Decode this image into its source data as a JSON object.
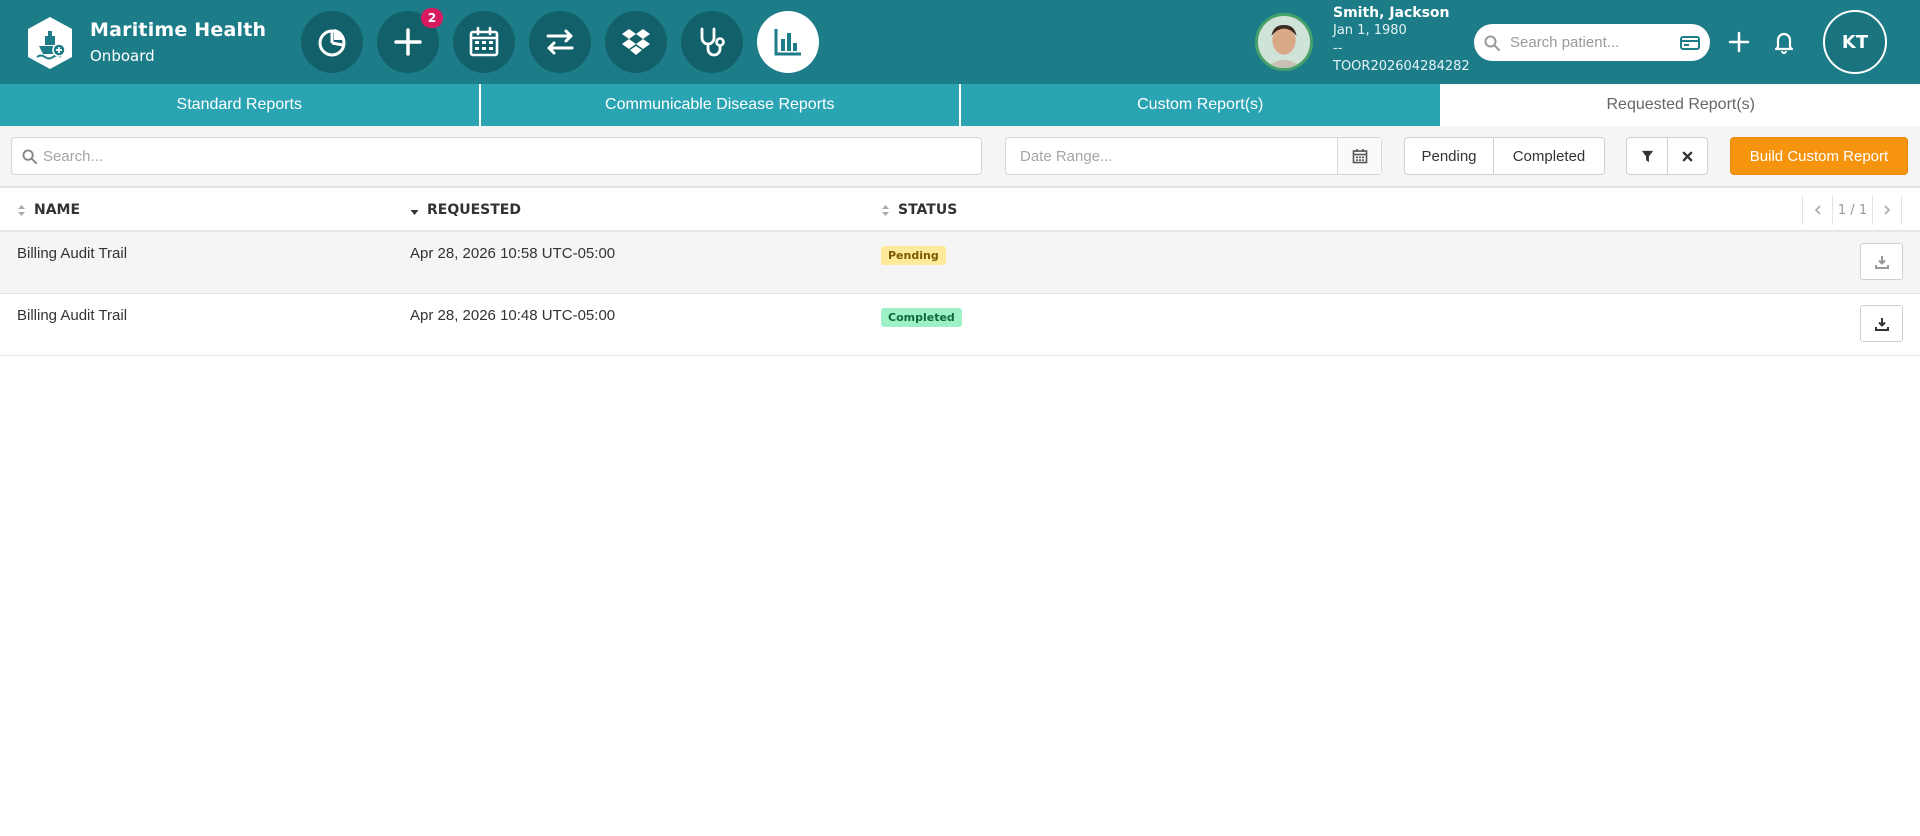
{
  "brand": {
    "title": "Maritime Health",
    "subtitle": "Onboard",
    "logo_icon": "ship-shield-icon"
  },
  "nav": {
    "items": [
      {
        "name": "dashboard",
        "icon": "pie-chart-icon"
      },
      {
        "name": "add",
        "icon": "plus-icon",
        "badge": "2"
      },
      {
        "name": "calendar",
        "icon": "calendar-icon"
      },
      {
        "name": "transfer",
        "icon": "arrows-exchange-icon"
      },
      {
        "name": "dropbox",
        "icon": "dropbox-icon"
      },
      {
        "name": "clinical",
        "icon": "stethoscope-icon"
      },
      {
        "name": "reports",
        "icon": "bar-chart-icon",
        "active": true
      }
    ]
  },
  "patient": {
    "name": "Smith, Jackson",
    "dob": "Jan 1, 1980",
    "extra": "--",
    "id": "TOOR202604284282"
  },
  "patient_search": {
    "placeholder": "Search patient..."
  },
  "user": {
    "initials": "KT"
  },
  "tabs": [
    {
      "label": "Standard Reports",
      "active": false
    },
    {
      "label": "Communicable Disease Reports",
      "active": false
    },
    {
      "label": "Custom Report(s)",
      "active": false
    },
    {
      "label": "Requested Report(s)",
      "active": true
    }
  ],
  "toolbar": {
    "search_placeholder": "Search...",
    "date_placeholder": "Date Range...",
    "pending_label": "Pending",
    "completed_label": "Completed",
    "build_label": "Build Custom Report"
  },
  "table": {
    "columns": {
      "name": "NAME",
      "requested": "REQUESTED",
      "status": "STATUS"
    },
    "pager": "1 / 1",
    "rows": [
      {
        "name": "Billing Audit Trail",
        "requested": "Apr 28, 2026 10:58 UTC-05:00",
        "status": "Pending"
      },
      {
        "name": "Billing Audit Trail",
        "requested": "Apr 28, 2026 10:48 UTC-05:00",
        "status": "Completed"
      }
    ]
  },
  "colors": {
    "topbar": "#1c7d89",
    "tabs": "#2aa4b3",
    "accent": "#f7940d",
    "pending": "#ffe99a",
    "completed": "#9ef0c6"
  }
}
